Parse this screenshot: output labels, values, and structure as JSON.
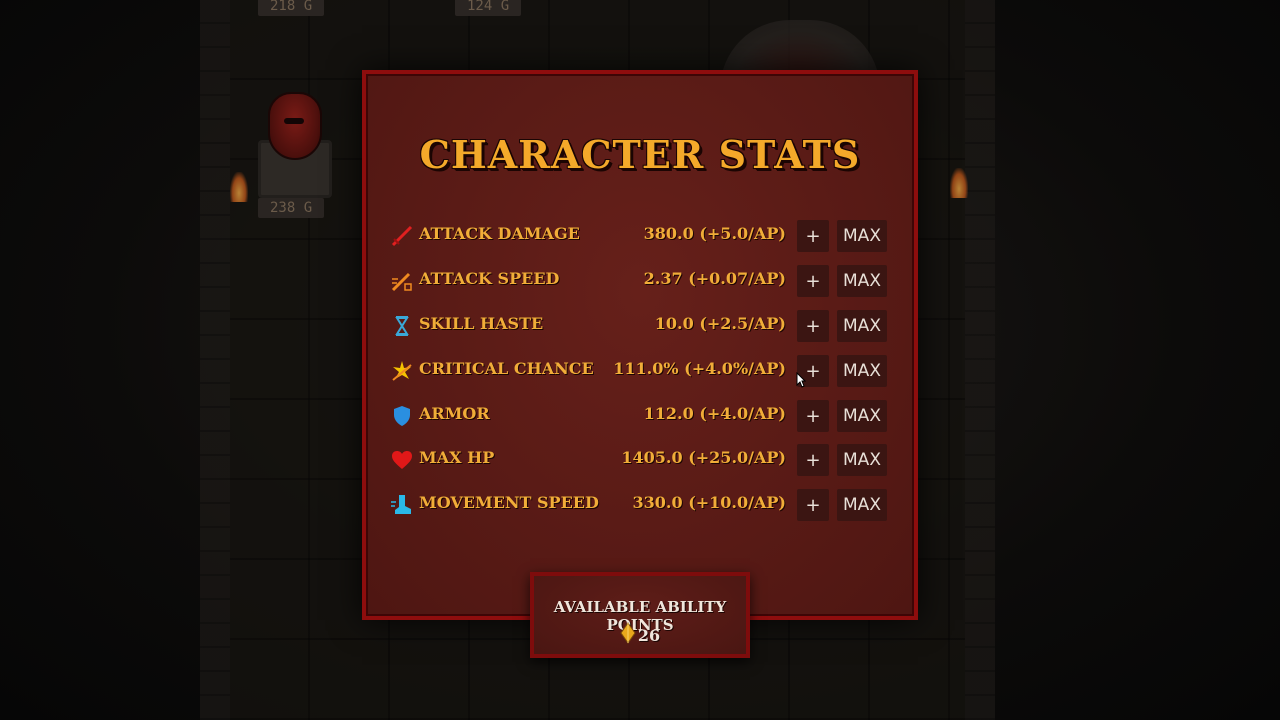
{
  "background": {
    "price_tags": [
      "218 G",
      "124 G",
      "238 G"
    ]
  },
  "panel": {
    "title": "CHARACTER STATS",
    "stats": [
      {
        "name": "ATTACK DAMAGE",
        "value": "380.0 (+5.0/AP)",
        "icon": "sword-icon",
        "plus_label": "+",
        "max_label": "MAX"
      },
      {
        "name": "ATTACK SPEED",
        "value": "2.37 (+0.07/AP)",
        "icon": "sword-speed-icon",
        "plus_label": "+",
        "max_label": "MAX"
      },
      {
        "name": "SKILL HASTE",
        "value": "10.0 (+2.5/AP)",
        "icon": "hourglass-icon",
        "plus_label": "+",
        "max_label": "MAX"
      },
      {
        "name": "CRITICAL CHANCE",
        "value": "111.0% (+4.0%/AP)",
        "icon": "critical-strike-icon",
        "plus_label": "+",
        "max_label": "MAX"
      },
      {
        "name": "ARMOR",
        "value": "112.0 (+4.0/AP)",
        "icon": "shield-icon",
        "plus_label": "+",
        "max_label": "MAX"
      },
      {
        "name": "MAX HP",
        "value": "1405.0 (+25.0/AP)",
        "icon": "heart-icon",
        "plus_label": "+",
        "max_label": "MAX"
      },
      {
        "name": "MOVEMENT SPEED",
        "value": "330.0 (+10.0/AP)",
        "icon": "boot-icon",
        "plus_label": "+",
        "max_label": "MAX"
      }
    ]
  },
  "points": {
    "label": "AVAILABLE ABILITY POINTS",
    "value": "26",
    "icon": "gem-icon"
  },
  "colors": {
    "accent": "#f1ad38",
    "panel_border": "#8e0d0d",
    "panel_bg": "#5a1b16",
    "button_bg": "#3b1512"
  }
}
